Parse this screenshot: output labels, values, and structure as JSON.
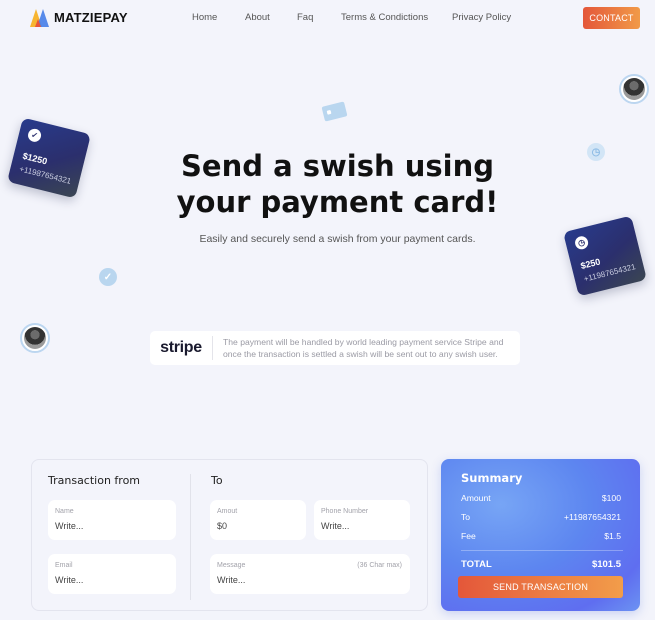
{
  "header": {
    "brand": "MATZIEPAY",
    "nav": [
      "Home",
      "About",
      "Faq",
      "Terms & Condictions",
      "Privacy Policy"
    ],
    "contact_label": "CONTACT"
  },
  "hero": {
    "title_line1": "Send a swish using",
    "title_line2": "your payment card!",
    "subtitle": "Easily and securely send a swish from your payment cards."
  },
  "decor": {
    "card_left": {
      "amount": "$1250",
      "phone": "+11987654321",
      "icon": "check-icon"
    },
    "card_right": {
      "amount": "$250",
      "phone": "+11987654321",
      "icon": "clock-icon"
    }
  },
  "stripe": {
    "logo": "stripe",
    "text_line1": "The payment will be handled by world leading payment service Stripe and",
    "text_line2": "once the transaction is settled a swish will be sent out to any swish user."
  },
  "transaction": {
    "from_heading": "Transaction from",
    "to_heading": "To",
    "fields": {
      "name": {
        "label": "Name",
        "value": "Write..."
      },
      "email": {
        "label": "Email",
        "value": "Write..."
      },
      "amount": {
        "label": "Amout",
        "value": "$0"
      },
      "phone": {
        "label": "Phone Number",
        "value": "Write..."
      },
      "message": {
        "label": "Message",
        "hint": "(36 Char max)",
        "value": "Write..."
      }
    }
  },
  "summary": {
    "title": "Summary",
    "rows": [
      {
        "label": "Amount",
        "value": "$100"
      },
      {
        "label": "To",
        "value": "+11987654321"
      },
      {
        "label": "Fee",
        "value": "$1.5"
      }
    ],
    "total_label": "TOTAL",
    "total_value": "$101.5",
    "send_label": "SEND TRANSACTION"
  },
  "colors": {
    "accent_orange": "#e4573a",
    "accent_blue": "#5d86f0",
    "background": "#f3f4fb"
  }
}
